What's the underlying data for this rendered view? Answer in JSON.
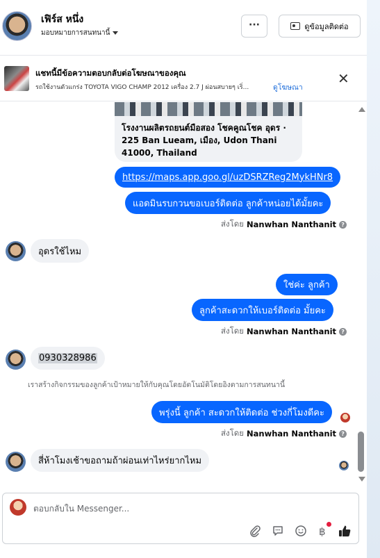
{
  "header": {
    "contact_name": "เฟิร์ส หนึ่ง",
    "assign_label": "มอบหมายการสนทนานี้",
    "more_label": "···",
    "view_contact_label": "ดูข้อมูลติดต่อ"
  },
  "ad_banner": {
    "title": "แชทนี้มีข้อความตอบกลับต่อโฆษณาของคุณ",
    "subtitle": "รถใช้งานตัวแกร่ง TOYOTA VIGO CHAMP 2012 เครื่อง 2.7 J ผ่อนสบายๆ เริ่...",
    "link_label": "ดูโฆษณา",
    "close_label": "✕"
  },
  "messages": {
    "map_name": "โรงงานผลิตรถยนต์มือสอง โชคคูณโชค อุดร · 225 Ban Lueam, เมือง, Udon Thani 41000, Thailand",
    "map_link": "https://maps.app.goo.gl/uzDSRZReg2MykHNr8",
    "out_1": "แอดมินรบกวนขอเบอร์ติดต่อ ลูกค้าหน่อยได้มั้ยคะ",
    "sent_by_prefix": "ส่งโดย",
    "agent_name": "Nanwhan Nanthanit",
    "in_1": "อุดรใช้ไหม",
    "out_2": "ใช่ค่ะ ลูกค้า",
    "out_3": "ลูกค้าสะดวกให้เบอร์ติดต่อ มั้ยคะ",
    "in_2": "0930328986",
    "system_note": "เราสร้างกิจกรรมของลูกค้าเป้าหมายให้กับคุณโดยอัตโนมัติโดยอิงตามการสนทนานี้",
    "out_4": "พรุ่งนี้ ลูกค้า สะดวกให้ติดต่อ ช่วงกี่โมงดีคะ",
    "in_3": "สี่ห้าโมงเช้าขอถามถ้าผ่อนเท่าไหร่ยากไหม"
  },
  "composer": {
    "placeholder": "ตอบกลับใน Messenger...",
    "icons": [
      "paperclip-icon",
      "chat-bubble-icon",
      "emoji-icon",
      "baht-icon",
      "thumbs-up-icon"
    ]
  },
  "colors": {
    "outgoing_bubble": "#0866ff",
    "incoming_bubble": "#f0f2f5",
    "link": "#216fdb"
  }
}
